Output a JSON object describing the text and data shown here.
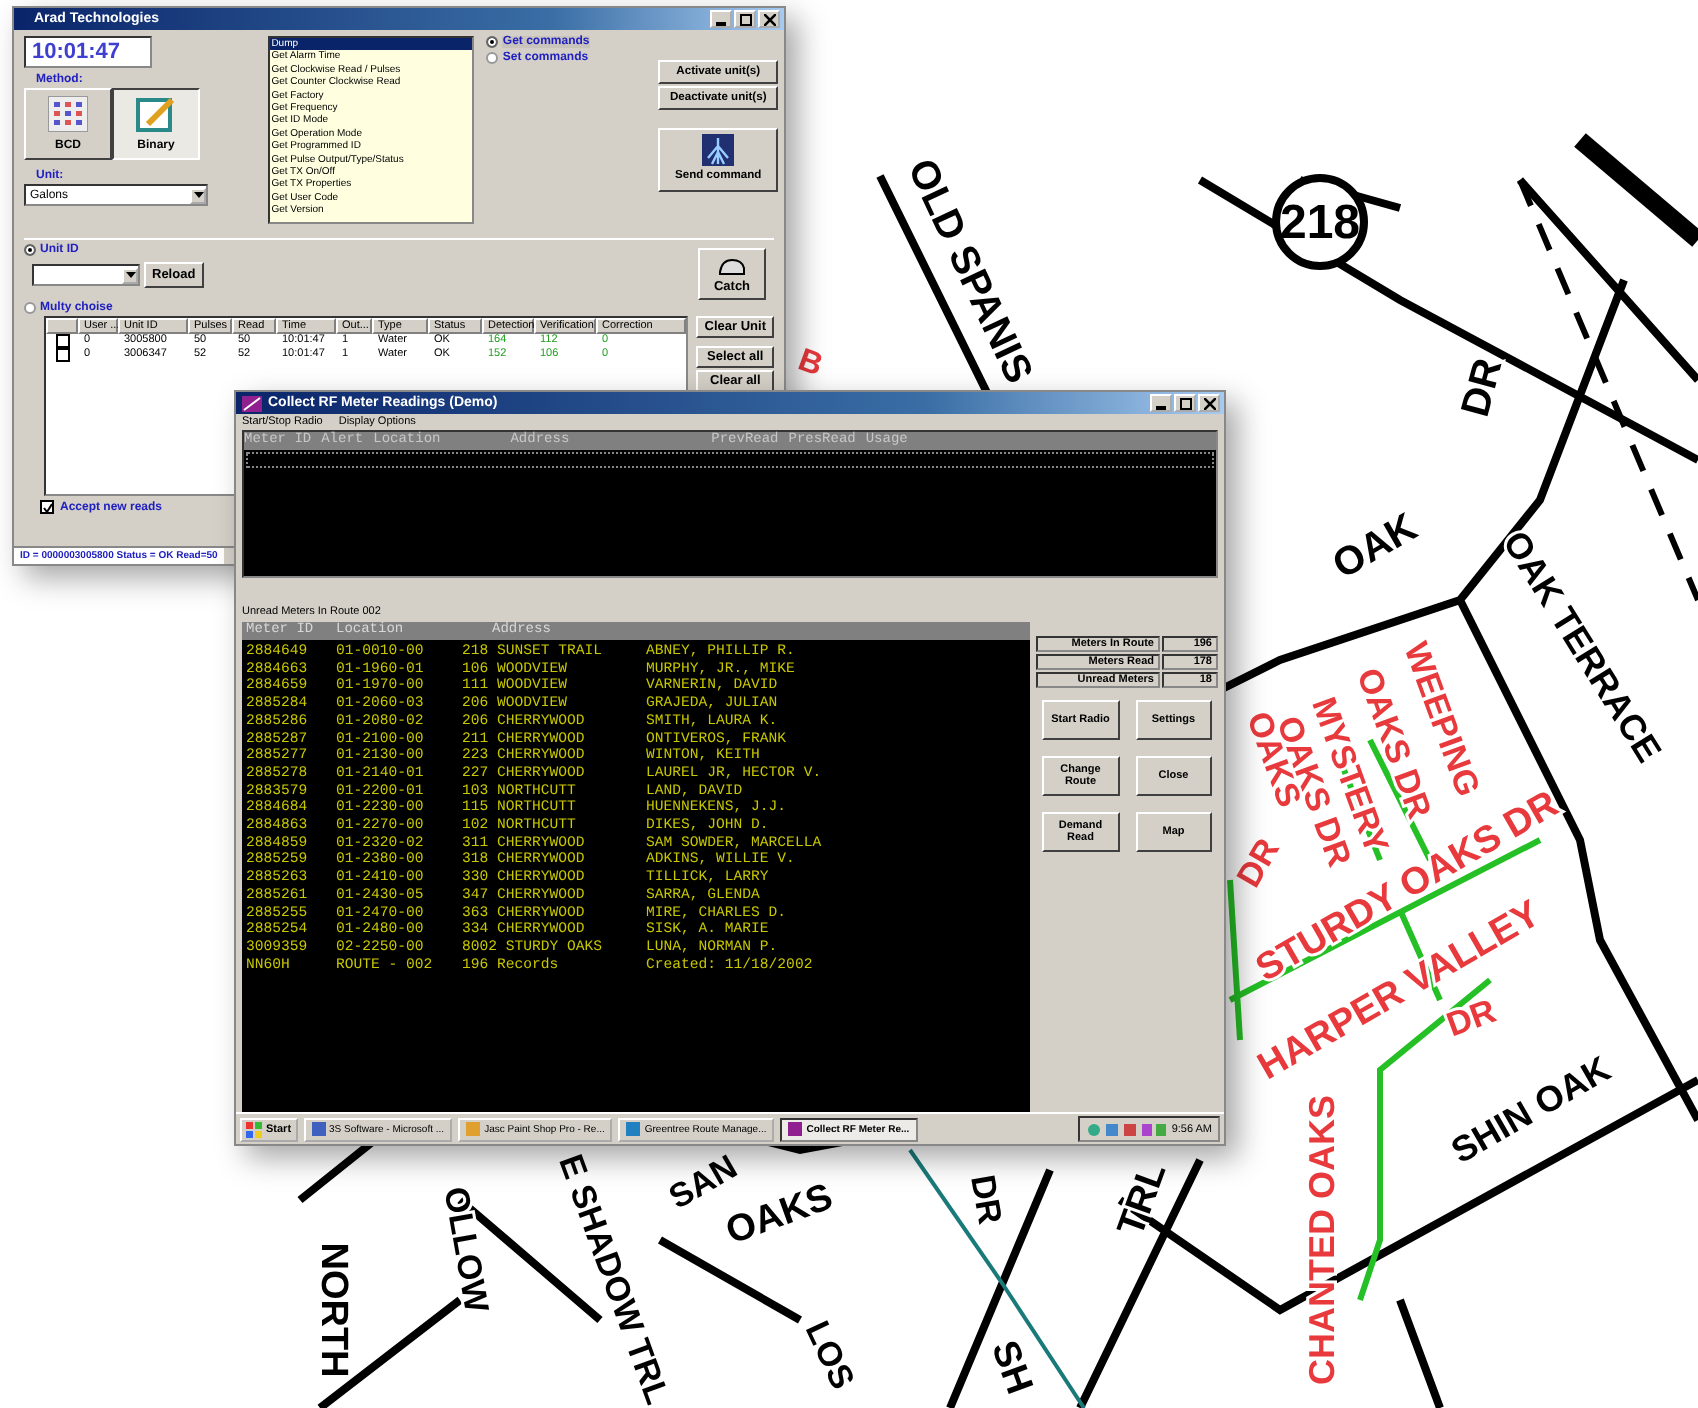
{
  "map": {
    "route_marker": "218",
    "labels": [
      {
        "text": "OLD SPANIS",
        "color": "#000000"
      },
      {
        "text": "DR",
        "color": "#000000"
      },
      {
        "text": "OAK",
        "color": "#000000"
      },
      {
        "text": "OAK TERRACE",
        "color": "#000000"
      },
      {
        "text": "WEEPING",
        "color": "#e8393c"
      },
      {
        "text": "OAKS DR",
        "color": "#e8393c"
      },
      {
        "text": "MYSTERY",
        "color": "#e8393c"
      },
      {
        "text": "OAKS DR",
        "color": "#e8393c"
      },
      {
        "text": "OAKS",
        "color": "#e8393c"
      },
      {
        "text": "DR",
        "color": "#e8393c"
      },
      {
        "text": "STURDY OAKS DR",
        "color": "#e8393c"
      },
      {
        "text": "HARPER VALLEY",
        "color": "#e8393c"
      },
      {
        "text": "DR",
        "color": "#e8393c"
      },
      {
        "text": "CHANTED OAKS",
        "color": "#e8393c"
      },
      {
        "text": "SHIN OAK",
        "color": "#000000"
      },
      {
        "text": "B",
        "color": "#e8393c"
      },
      {
        "text": "NORTH",
        "color": "#000000"
      },
      {
        "text": "OLLOW",
        "color": "#000000"
      },
      {
        "text": "E SHADOW TRL",
        "color": "#000000"
      },
      {
        "text": "SAN",
        "color": "#000000"
      },
      {
        "text": "OAKS",
        "color": "#000000"
      },
      {
        "text": "LOS",
        "color": "#000000"
      },
      {
        "text": "SH",
        "color": "#000000"
      },
      {
        "text": "DR",
        "color": "#000000"
      },
      {
        "text": "TRL",
        "color": "#000000"
      }
    ]
  },
  "control_window": {
    "title": "Arad Technologies",
    "clock": "10:01:47",
    "method": {
      "label": "Method:",
      "options": [
        {
          "label": "BCD",
          "selected": false
        },
        {
          "label": "Binary",
          "selected": true
        }
      ]
    },
    "unit": {
      "label": "Unit:",
      "value": "Galons"
    },
    "commands": [
      {
        "label": "Dump",
        "selected": true
      },
      {
        "label": "Get Alarm Time",
        "selected": false
      },
      {
        "label": "Get Clockwise Read / Pulses",
        "selected": false
      },
      {
        "label": "Get Counter Clockwise Read",
        "selected": false
      },
      {
        "label": "Get Factory",
        "selected": false
      },
      {
        "label": "Get Frequency",
        "selected": false
      },
      {
        "label": "Get ID Mode",
        "selected": false
      },
      {
        "label": "Get Operation Mode",
        "selected": false
      },
      {
        "label": "Get Programmed ID",
        "selected": false
      },
      {
        "label": "Get Pulse Output/Type/Status",
        "selected": false
      },
      {
        "label": "Get TX On/Off",
        "selected": false
      },
      {
        "label": "Get TX Properties",
        "selected": false
      },
      {
        "label": "Get User Code",
        "selected": false
      },
      {
        "label": "Get Version",
        "selected": false
      }
    ],
    "command_modes": [
      {
        "label": "Get commands",
        "selected": true
      },
      {
        "label": "Set commands",
        "selected": false
      }
    ],
    "buttons": {
      "activate": "Activate unit(s)",
      "deactivate": "Deactivate unit(s)",
      "send": "Send command",
      "reload": "Reload",
      "catch": "Catch",
      "clear_unit": "Clear Unit",
      "select_all": "Select all",
      "clear_all": "Clear all"
    },
    "selection_modes": [
      {
        "label": "Unit ID",
        "selected": true
      },
      {
        "label": "Multy choise",
        "selected": false
      }
    ],
    "table": {
      "columns": [
        "User ...",
        "Unit ID",
        "Pulses",
        "Read",
        "Time",
        "Out...",
        "Type",
        "Status",
        "Detection",
        "Verification",
        "Correction"
      ],
      "rows": [
        {
          "checked": false,
          "cells": [
            "0",
            "3005800",
            "50",
            "50",
            "10:01:47",
            "1",
            "Water",
            "OK",
            "164",
            "112",
            "0"
          ]
        },
        {
          "checked": false,
          "cells": [
            "0",
            "3006347",
            "52",
            "52",
            "10:01:47",
            "1",
            "Water",
            "OK",
            "152",
            "106",
            "0"
          ]
        }
      ]
    },
    "accept_new_reads": {
      "label": "Accept new reads",
      "checked": true
    },
    "status_bar": "ID = 0000003005800  Status = OK  Read=50"
  },
  "meter_window": {
    "title": "Collect RF Meter Readings (Demo)",
    "menu": [
      "Start/Stop Radio",
      "Display Options"
    ],
    "readings_columns": [
      "Meter ID",
      "Alert",
      "Location",
      "Address",
      "PrevRead",
      "PresRead",
      "Usage"
    ],
    "unread_label": "Unread Meters In Route 002",
    "unread_columns": [
      "Meter ID",
      "Location",
      "Address"
    ],
    "unread_rows": [
      [
        "2884649",
        "01-0010-00",
        "218 SUNSET TRAIL",
        "ABNEY, PHILLIP R."
      ],
      [
        "2884663",
        "01-1960-01",
        "106 WOODVIEW",
        "MURPHY, JR., MIKE"
      ],
      [
        "2884659",
        "01-1970-00",
        "111 WOODVIEW",
        "VARNERIN, DAVID"
      ],
      [
        "2885284",
        "01-2060-03",
        "206 WOODVIEW",
        "GRAJEDA, JULIAN"
      ],
      [
        "2885286",
        "01-2080-02",
        "206 CHERRYWOOD",
        "SMITH, LAURA K."
      ],
      [
        "2885287",
        "01-2100-00",
        "211 CHERRYWOOD",
        "ONTIVEROS, FRANK"
      ],
      [
        "2885277",
        "01-2130-00",
        "223 CHERRYWOOD",
        "WINTON, KEITH"
      ],
      [
        "2885278",
        "01-2140-01",
        "227 CHERRYWOOD",
        "LAUREL JR, HECTOR V."
      ],
      [
        "2883579",
        "01-2200-01",
        "103 NORTHCUTT",
        "LAND, DAVID"
      ],
      [
        "2884684",
        "01-2230-00",
        "115 NORTHCUTT",
        "HUENNEKENS, J.J."
      ],
      [
        "2884863",
        "01-2270-00",
        "102 NORTHCUTT",
        "DIKES, JOHN D."
      ],
      [
        "2884859",
        "01-2320-02",
        "311 CHERRYWOOD",
        "SAM SOWDER, MARCELLA"
      ],
      [
        "2885259",
        "01-2380-00",
        "318 CHERRYWOOD",
        "ADKINS, WILLIE V."
      ],
      [
        "2885263",
        "01-2410-00",
        "330 CHERRYWOOD",
        "TILLICK, LARRY"
      ],
      [
        "2885261",
        "01-2430-05",
        "347 CHERRYWOOD",
        "SARRA, GLENDA"
      ],
      [
        "2885255",
        "01-2470-00",
        "363 CHERRYWOOD",
        "MIRE, CHARLES D."
      ],
      [
        "2885254",
        "01-2480-00",
        "334 CHERRYWOOD",
        "SISK, A. MARIE"
      ],
      [
        "3009359",
        "02-2250-00",
        "8002 STURDY OAKS",
        "LUNA, NORMAN P."
      ],
      [
        "NN60H",
        "ROUTE - 002",
        "196 Records",
        "Created: 11/18/2002"
      ]
    ],
    "stats": [
      {
        "label": "Meters In Route",
        "value": "196"
      },
      {
        "label": "Meters Read",
        "value": "178"
      },
      {
        "label": "Unread Meters",
        "value": "18"
      }
    ],
    "buttons": [
      "Start Radio",
      "Settings",
      "Change Route",
      "Close",
      "Demand Read",
      "Map"
    ],
    "taskbar": {
      "start": "Start",
      "tasks": [
        {
          "label": "3S Software - Microsoft ...",
          "selected": false
        },
        {
          "label": "Jasc Paint Shop Pro - Re...",
          "selected": false
        },
        {
          "label": "Greentree Route Manage...",
          "selected": false
        },
        {
          "label": "Collect RF Meter Re...",
          "selected": true
        }
      ],
      "time": "9:56 AM"
    }
  }
}
